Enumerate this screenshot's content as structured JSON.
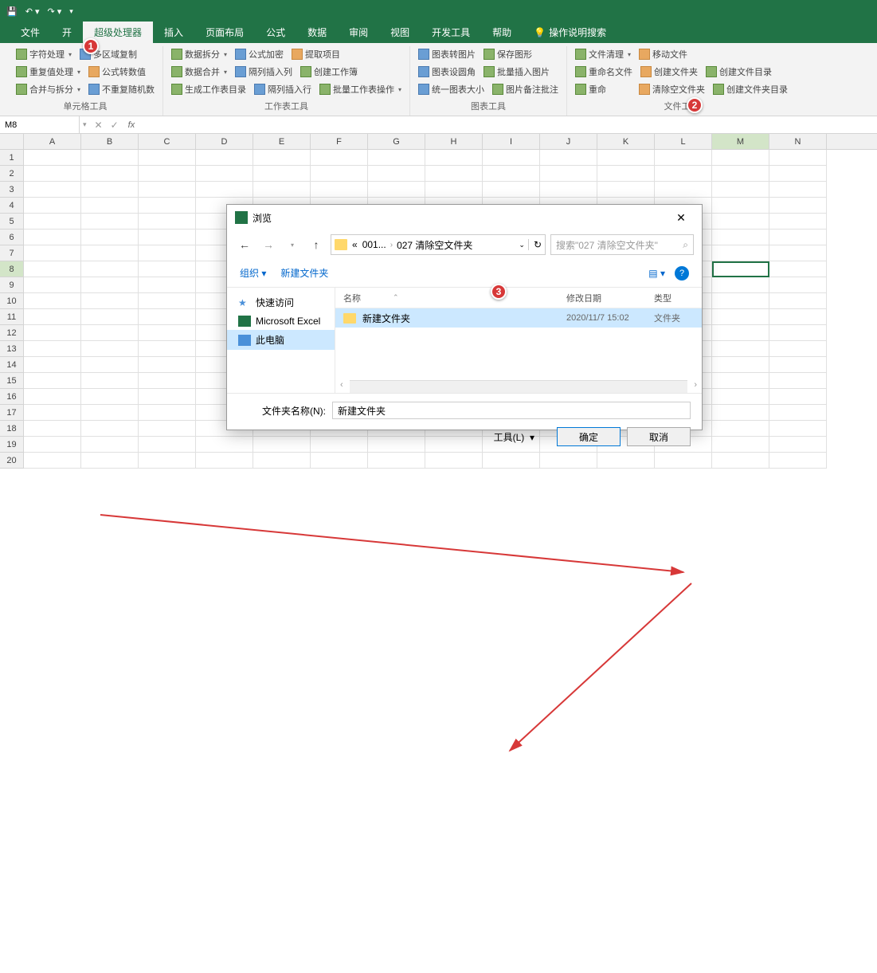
{
  "titlebar": {
    "save_icon": "💾"
  },
  "tabs": {
    "file": "文件",
    "start": "开",
    "super": "超级处理器",
    "insert": "插入",
    "layout": "页面布局",
    "formula": "公式",
    "data": "数据",
    "review": "审阅",
    "view": "视图",
    "dev": "开发工具",
    "help": "帮助",
    "tellme": "操作说明搜索"
  },
  "ribbon": {
    "g1": {
      "char_proc": "字符处理",
      "dup_proc": "重复值处理",
      "merge_split": "合并与拆分",
      "multi_copy": "多区域复制",
      "col_to_num": "公式转数值",
      "no_dup_rand": "不重复随机数",
      "label": "单元格工具"
    },
    "g2": {
      "data_split": "数据拆分",
      "data_merge": "数据合并",
      "gen_dir": "生成工作表目录",
      "fml_encrypt": "公式加密",
      "alt_ins_row": "隔列插入列",
      "alt_ins_col": "隔列插入行",
      "extract": "提取项目",
      "create_wb": "创建工作簿",
      "batch_ws": "批量工作表操作",
      "label": "工作表工具"
    },
    "g3": {
      "chart_pic": "图表转图片",
      "chart_corner": "图表设圆角",
      "chart_size": "统一图表大小",
      "save_fig": "保存图形",
      "batch_ins_pic": "批量插入图片",
      "pic_note": "图片备注批注",
      "label": "图表工具"
    },
    "g4": {
      "file_clean": "文件清理",
      "rename": "重命名文件",
      "rename2": "重命",
      "move": "移动文件",
      "create_folder": "创建文件夹",
      "clear_empty": "清除空文件夹",
      "create_dir": "创建文件目录",
      "create_folder_dir": "创建文件夹目录",
      "label": "文件工具"
    }
  },
  "namebox": "M8",
  "fx": "fx",
  "cols": [
    "A",
    "B",
    "C",
    "D",
    "E",
    "F",
    "G",
    "H",
    "I",
    "J",
    "K",
    "L",
    "M",
    "N"
  ],
  "rows": [
    "1",
    "2",
    "3",
    "4",
    "5",
    "6",
    "7",
    "8",
    "9",
    "10",
    "11",
    "12",
    "13",
    "14",
    "15",
    "16",
    "17",
    "18",
    "19",
    "20"
  ],
  "dialog": {
    "title": "浏览",
    "path1": "001...",
    "path2": "027 清除空文件夹",
    "search_placeholder": "搜索\"027 清除空文件夹\"",
    "organize": "组织",
    "new_folder": "新建文件夹",
    "sidebar": {
      "quick": "快速访问",
      "excel": "Microsoft Excel",
      "pc": "此电脑"
    },
    "cols": {
      "name": "名称",
      "date": "修改日期",
      "type": "类型"
    },
    "file": {
      "name": "新建文件夹",
      "date": "2020/11/7 15:02",
      "type": "文件夹"
    },
    "folder_label": "文件夹名称(N):",
    "folder_value": "新建文件夹",
    "tools": "工具(L)",
    "ok": "确定",
    "cancel": "取消"
  },
  "callouts": {
    "c1": "1",
    "c2": "2",
    "c3": "3"
  }
}
